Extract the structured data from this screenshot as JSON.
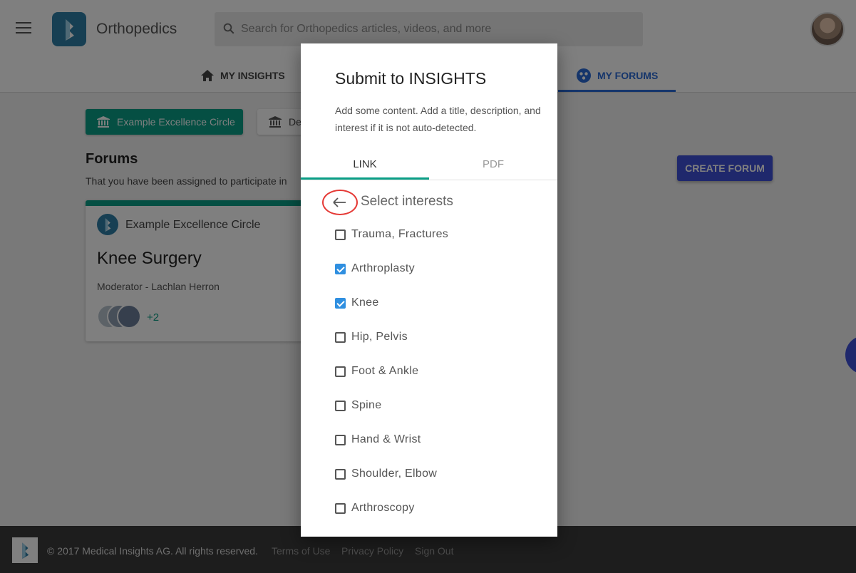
{
  "header": {
    "app_title": "Orthopedics",
    "search_placeholder": "Search for Orthopedics articles, videos, and more"
  },
  "nav": {
    "tabs": [
      {
        "label": "MY INSIGHTS",
        "icon": "home-icon"
      },
      {
        "label": "MY FORUMS",
        "icon": "forums-icon",
        "active": true
      }
    ]
  },
  "main": {
    "chips": [
      {
        "label": "Example Excellence Circle",
        "icon": "institution-icon",
        "active": true
      },
      {
        "label": "De",
        "icon": "institution-icon",
        "active": false
      }
    ],
    "forums_title": "Forums",
    "forums_subtitle": "That you have been assigned to participate in",
    "create_button": "CREATE FORUM",
    "forum_card": {
      "circle": "Example Excellence Circle",
      "title": "Knee Surgery",
      "moderator": "Moderator - Lachlan Herron",
      "extra_members": "+2"
    }
  },
  "footer": {
    "copyright": "© 2017 Medical Insights AG. All rights reserved.",
    "links": [
      "Terms of Use",
      "Privacy Policy",
      "Sign Out"
    ]
  },
  "dialog": {
    "title": "Submit to INSIGHTS",
    "description": "Add some content. Add a title, description, and interest if it is not auto-detected.",
    "tabs": [
      "LINK",
      "PDF"
    ],
    "active_tab": "LINK",
    "section_title": "Select interests",
    "interests": [
      {
        "label": "Trauma, Fractures",
        "checked": false
      },
      {
        "label": "Arthroplasty",
        "checked": true
      },
      {
        "label": "Knee",
        "checked": true
      },
      {
        "label": "Hip, Pelvis",
        "checked": false
      },
      {
        "label": "Foot & Ankle",
        "checked": false
      },
      {
        "label": "Spine",
        "checked": false
      },
      {
        "label": "Hand & Wrist",
        "checked": false
      },
      {
        "label": "Shoulder, Elbow",
        "checked": false
      },
      {
        "label": "Arthroscopy",
        "checked": false
      }
    ]
  },
  "colors": {
    "teal": "#0a9e86",
    "blue": "#3f51d8",
    "link_blue": "#2a6bd6",
    "check_blue": "#2f8fe0",
    "highlight_red": "#e53935"
  }
}
